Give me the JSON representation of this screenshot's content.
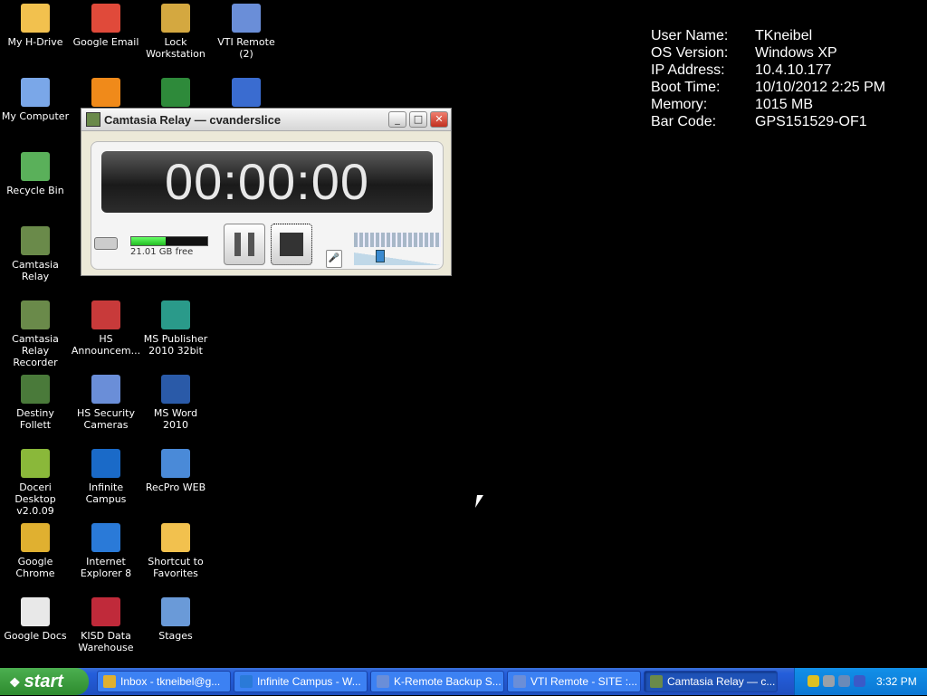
{
  "desktop": {
    "icons": [
      {
        "label": "My H-Drive",
        "icon": "folder-icon",
        "color": "#f2c14e"
      },
      {
        "label": "Google Email",
        "icon": "gmail-icon",
        "color": "#e04a3a"
      },
      {
        "label": "Lock Workstation",
        "icon": "lock-icon",
        "color": "#d4a840"
      },
      {
        "label": "VTI Remote (2)",
        "icon": "vti-remote-icon",
        "color": "#6a8ed8"
      },
      {
        "label": "My Computer",
        "icon": "computer-icon",
        "color": "#7aa7e8"
      },
      {
        "label": "",
        "icon": "moodle-icon",
        "color": "#f08a1a"
      },
      {
        "label": "",
        "icon": "excel-icon",
        "color": "#2e8a3a"
      },
      {
        "label": "",
        "icon": "media-player-icon",
        "color": "#3a6cd0"
      },
      {
        "label": "Recycle Bin",
        "icon": "recycle-bin-icon",
        "color": "#5ab05a"
      },
      {
        "label": "Camtasia Relay",
        "icon": "camtasia-relay-icon",
        "color": "#6a8a4a"
      },
      {
        "label": "Camtasia Relay Recorder",
        "icon": "camtasia-recorder-icon",
        "color": "#6a8a4a"
      },
      {
        "label": "HS Announcem...",
        "icon": "announcement-icon",
        "color": "#c83a3a"
      },
      {
        "label": "MS Publisher 2010 32bit",
        "icon": "publisher-icon",
        "color": "#2a9a8a"
      },
      {
        "label": "Destiny Follett",
        "icon": "destiny-icon",
        "color": "#4a7a3a"
      },
      {
        "label": "HS Security Cameras",
        "icon": "security-camera-icon",
        "color": "#6a8ed8"
      },
      {
        "label": "MS Word 2010",
        "icon": "word-icon",
        "color": "#2a5aa8"
      },
      {
        "label": "Doceri Desktop v2.0.09",
        "icon": "doceri-icon",
        "color": "#8ab83a"
      },
      {
        "label": "Infinite Campus",
        "icon": "infinite-campus-icon",
        "color": "#1a6ac8"
      },
      {
        "label": "RecPro WEB",
        "icon": "recpro-icon",
        "color": "#4a8ad8"
      },
      {
        "label": "Google Chrome",
        "icon": "chrome-icon",
        "color": "#e0b030"
      },
      {
        "label": "Internet Explorer 8",
        "icon": "internet-explorer-icon",
        "color": "#2a7ad8"
      },
      {
        "label": "Shortcut to Favorites",
        "icon": "favorites-folder-icon",
        "color": "#f2c14e"
      },
      {
        "label": "Google Docs",
        "icon": "google-docs-icon",
        "color": "#e8e8e8"
      },
      {
        "label": "KISD Data Warehouse",
        "icon": "data-warehouse-icon",
        "color": "#c02a3a"
      },
      {
        "label": "Stages",
        "icon": "stages-icon",
        "color": "#6a9ad8"
      }
    ]
  },
  "sysinfo": [
    {
      "key": "User Name:",
      "value": "TKneibel"
    },
    {
      "key": "OS Version:",
      "value": "Windows XP"
    },
    {
      "key": "IP Address:",
      "value": "10.4.10.177"
    },
    {
      "key": "Boot Time:",
      "value": "10/10/2012 2:25 PM"
    },
    {
      "key": "Memory:",
      "value": "1015 MB"
    },
    {
      "key": "Bar Code:",
      "value": "GPS151529-OF1"
    }
  ],
  "relay": {
    "title": "Camtasia Relay — cvanderslice",
    "timer": "00:00:00",
    "disk_free": "21.01 GB free",
    "disk_fraction_used": 0.45
  },
  "taskbar": {
    "start_label": "start",
    "tasks": [
      {
        "label": "Inbox - tkneibel@g...",
        "icon": "chrome-icon",
        "color": "#e0b030",
        "active": false
      },
      {
        "label": "Infinite Campus - W...",
        "icon": "internet-explorer-icon",
        "color": "#2a7ad8",
        "active": false
      },
      {
        "label": "K-Remote Backup S...",
        "icon": "remote-icon",
        "color": "#6a8ed8",
        "active": false
      },
      {
        "label": "VTI Remote - SITE :...",
        "icon": "vti-remote-icon",
        "color": "#6a8ed8",
        "active": false
      },
      {
        "label": "Camtasia Relay — c...",
        "icon": "camtasia-relay-icon",
        "color": "#6a8a4a",
        "active": true
      }
    ],
    "tray_icons": [
      {
        "icon": "security-tray-icon",
        "color": "#e0c020"
      },
      {
        "icon": "volume-tray-icon",
        "color": "#9aa0a8"
      },
      {
        "icon": "network-tray-icon",
        "color": "#6a8ab8"
      },
      {
        "icon": "update-tray-icon",
        "color": "#3a5ac8"
      }
    ],
    "clock": "3:32 PM"
  }
}
